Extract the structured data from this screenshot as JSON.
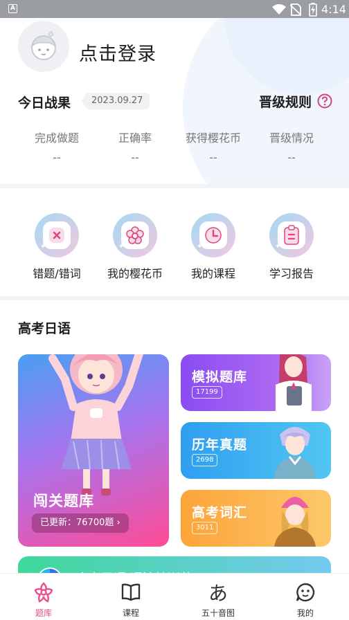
{
  "status_bar": {
    "notification_icon": "A",
    "time": "4:14"
  },
  "header": {
    "login_label": "点击登录",
    "avatar_icon": "avatar-placeholder"
  },
  "today": {
    "title": "今日战果",
    "date": "2023.09.27",
    "rules_label": "晋级规则",
    "stats": [
      {
        "label": "完成做题",
        "value": "--"
      },
      {
        "label": "正确率",
        "value": "--"
      },
      {
        "label": "获得樱花币",
        "value": "--"
      },
      {
        "label": "晋级情况",
        "value": "--"
      }
    ]
  },
  "quick_actions": [
    {
      "label": "错题/错词",
      "icon": "error-book-icon"
    },
    {
      "label": "我的樱花币",
      "icon": "sakura-coin-icon"
    },
    {
      "label": "我的课程",
      "icon": "clock-icon"
    },
    {
      "label": "学习报告",
      "icon": "clipboard-icon"
    }
  ],
  "section": {
    "title": "高考日语",
    "big_card": {
      "title": "闯关题库",
      "updated": "已更新：76700题 ›"
    },
    "cards": [
      {
        "title": "模拟题库",
        "count": "17199"
      },
      {
        "title": "历年真题",
        "count": "2698"
      },
      {
        "title": "高考词汇",
        "count": "3011"
      }
    ],
    "banner": {
      "text": "高考日语 语法精训营",
      "chevron": "›"
    }
  },
  "tabs": [
    {
      "label": "题库",
      "icon": "flower-icon",
      "active": true
    },
    {
      "label": "课程",
      "icon": "book-icon",
      "active": false
    },
    {
      "label": "五十音图",
      "icon": "hiragana-icon",
      "glyph": "あ",
      "active": false
    },
    {
      "label": "我的",
      "icon": "chat-face-icon",
      "active": false
    }
  ],
  "colors": {
    "accent": "#ea4f8d",
    "help": "#d6408a"
  }
}
